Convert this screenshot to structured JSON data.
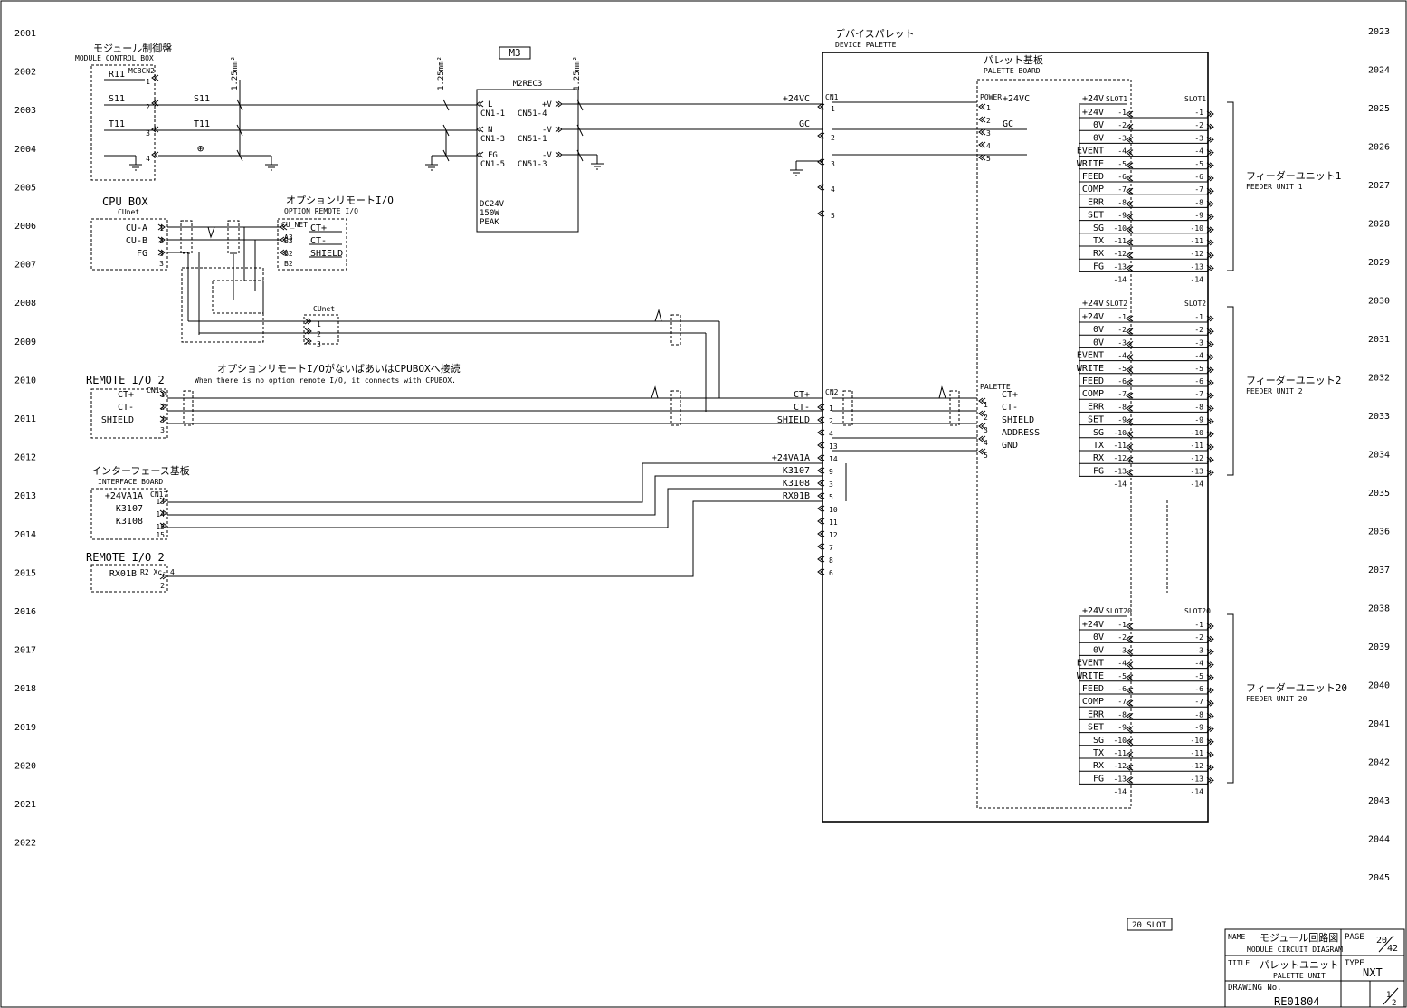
{
  "rows_left": [
    "2001",
    "2002",
    "2003",
    "2004",
    "2005",
    "2006",
    "2007",
    "2008",
    "2009",
    "2010",
    "2011",
    "2012",
    "2013",
    "2014",
    "2015",
    "2016",
    "2017",
    "2018",
    "2019",
    "2020",
    "2021",
    "2022"
  ],
  "rows_right": [
    "2023",
    "2024",
    "2025",
    "2026",
    "2027",
    "2028",
    "2029",
    "2030",
    "2031",
    "2032",
    "2033",
    "2034",
    "2035",
    "2036",
    "2037",
    "2038",
    "2039",
    "2040",
    "2041",
    "2042",
    "2043",
    "2044",
    "2045"
  ],
  "module_control_box": {
    "title_jp": "モジュール制御盤",
    "title_en": "MODULE CONTROL BOX",
    "connector": "MCBCN2",
    "signals": [
      "R11",
      "S11",
      "T11"
    ],
    "pins": [
      "1",
      "2",
      "3",
      "4"
    ]
  },
  "power_lines": {
    "s11": "S11",
    "t11": "T11",
    "wire_size": "1.25mm²",
    "ground": "⊕"
  },
  "m3": {
    "label": "M3",
    "model": "M2REC3",
    "left_pins": [
      "L",
      "N",
      "FG"
    ],
    "left_cn": [
      "CN1-1",
      "CN1-3",
      "CN1-5"
    ],
    "right_pins": [
      "+V",
      "-V",
      "-V"
    ],
    "right_cn": [
      "CN51-4",
      "CN51-1",
      "CN51-3"
    ],
    "spec": [
      "DC24V",
      "150W",
      "PEAK"
    ]
  },
  "cpu_box": {
    "title": "CPU BOX",
    "net": "CUnet",
    "signals": [
      "CU-A",
      "CU-B",
      "FG"
    ],
    "pins": [
      "1",
      "2",
      "3"
    ]
  },
  "option_remote": {
    "title_jp": "オプションリモートI/O",
    "title_en": "OPTION REMOTE I/O",
    "connector": "CU_NET",
    "signals": [
      "CT+",
      "CT-",
      "SHIELD"
    ],
    "pins": [
      "A3",
      "B3",
      "B2"
    ]
  },
  "cunet_label": "CUnet",
  "cunet_pins": [
    "1",
    "2",
    "3"
  ],
  "remote_io2_a": {
    "title": "REMOTE I/O 2",
    "connector": "CN1-",
    "signals": [
      "CT+",
      "CT-",
      "SHIELD"
    ],
    "pins": [
      "1",
      "2",
      "3"
    ]
  },
  "note_jp": "オプションリモートI/OがないばあいはCPUBOXへ接続",
  "note_en": "When there is no option remote I/O, it connects with CPUBOX.",
  "interface_board": {
    "title_jp": "インターフェース基板",
    "title_en": "INTERFACE BOARD",
    "connector": "CN17",
    "signals": [
      "+24VA1A",
      "K3107",
      "K3108"
    ],
    "pins": [
      "13",
      "14",
      "15"
    ]
  },
  "remote_io2_b": {
    "title": "REMOTE I/O 2",
    "connector": "R2 Xc-",
    "signals": [
      "RX01B"
    ],
    "pins": [
      "4",
      "2"
    ]
  },
  "device_palette": {
    "title_jp": "デバイスパレット",
    "title_en": "DEVICE PALETTE",
    "cn1": "CN1",
    "cn1_signals": [
      "+24VC",
      "GC"
    ],
    "cn1_pins": [
      "1",
      "2",
      "3",
      "4",
      "5"
    ],
    "cn2": "CN2",
    "cn2_signals": [
      "CT+",
      "CT-",
      "SHIELD",
      "+24VA1A",
      "K3107",
      "K3108",
      "RX01B"
    ],
    "cn2_pins": [
      "1",
      "2",
      "4",
      "13",
      "14",
      "9",
      "3",
      "5",
      "10",
      "11",
      "12",
      "7",
      "8",
      "6"
    ]
  },
  "palette_board": {
    "title_jp": "パレット基板",
    "title_en": "PALETTE BOARD",
    "power": "POWER",
    "power_signals": [
      "+24VC",
      "GC"
    ],
    "power_pins": [
      "1",
      "2",
      "3",
      "4",
      "5"
    ],
    "palette": "PALETTE",
    "palette_signals": [
      "CT+",
      "CT-",
      "SHIELD",
      "ADDRESS",
      "GND"
    ],
    "palette_pins": [
      "1",
      "2",
      "3",
      "4",
      "5"
    ]
  },
  "feeder_signals": [
    "+24V",
    "0V",
    "0V",
    "EVENT",
    "WRITE",
    "FEED",
    "COMP",
    "ERR",
    "SET",
    "SG",
    "TX",
    "RX",
    "FG"
  ],
  "feeder_units": [
    {
      "head": "+24V",
      "slot": "SLOT1",
      "jp": "フィーダーユニット1",
      "en": "FEEDER UNIT 1"
    },
    {
      "head": "+24V",
      "slot": "SLOT2",
      "jp": "フィーダーユニット2",
      "en": "FEEDER UNIT 2"
    },
    {
      "head": "+24V",
      "slot": "SLOT20",
      "jp": "フィーダーユニット20",
      "en": "FEEDER UNIT 20"
    }
  ],
  "slot_badge": "20 SLOT",
  "title_block": {
    "name_label": "NAME",
    "name_jp": "モジュール回路図",
    "name_en": "MODULE CIRCUIT DIAGRAM",
    "page_label": "PAGE",
    "page": "20",
    "pages": "42",
    "title_label": "TITLE",
    "title_jp": "パレットユニット",
    "title_en": "PALETTE UNIT",
    "type_label": "TYPE",
    "type": "NXT",
    "drawing_label": "DRAWING No.",
    "drawing_no": "RE01804",
    "sheet": "1",
    "sheets": "2"
  }
}
